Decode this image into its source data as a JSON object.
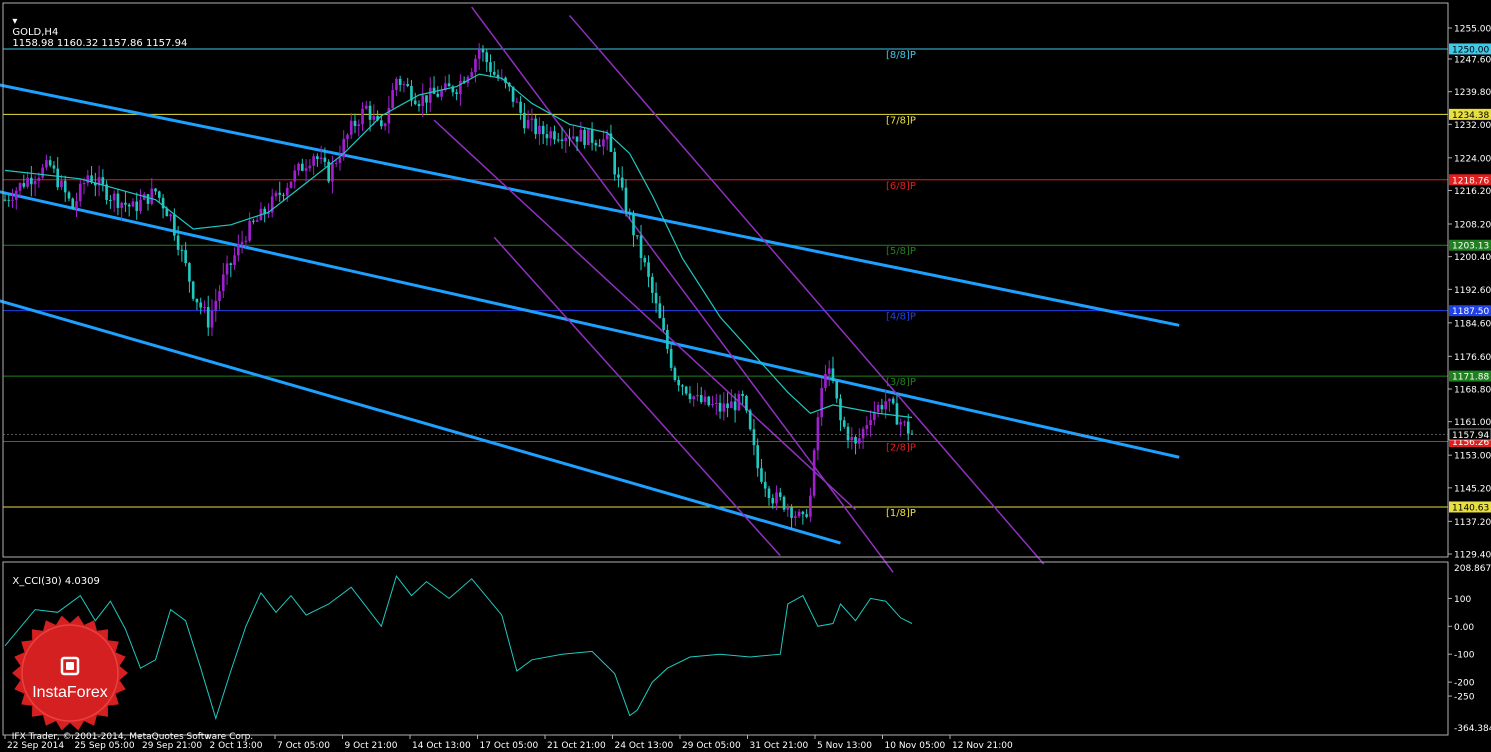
{
  "header": {
    "symbol": "GOLD,H4",
    "ohlc": "1158.98 1160.32 1157.86 1157.94",
    "indicator": "X_CCI(30) 4.0309"
  },
  "footer": {
    "copyright": "IFX Trader, © 2001-2014, MetaQuotes Software Corp."
  },
  "logo": {
    "text": "InstaForex",
    "color": "#d42020"
  },
  "colors": {
    "background": "#000000",
    "bull": "#a020d0",
    "bear": "#20c8c0",
    "ma": "#20c8c0",
    "channel_outer": "#1ea0ff",
    "channel_inner": "#9030c0",
    "cci": "#20c8c0"
  },
  "chart_data": [
    {
      "type": "candlestick",
      "symbol": "GOLD",
      "timeframe": "H4",
      "y_ticks": [
        1255.0,
        1247.6,
        1239.8,
        1232.0,
        1224.0,
        1216.2,
        1208.2,
        1200.4,
        1192.6,
        1184.6,
        1176.6,
        1168.8,
        1161.0,
        1153.0,
        1145.2,
        1137.2,
        1129.4
      ],
      "ylim": [
        1129.4,
        1255.0
      ],
      "x_ticks": [
        "22 Sep 2014",
        "25 Sep 05:00",
        "29 Sep 21:00",
        "2 Oct 13:00",
        "7 Oct 05:00",
        "9 Oct 21:00",
        "14 Oct 13:00",
        "17 Oct 05:00",
        "21 Oct 21:00",
        "24 Oct 13:00",
        "29 Oct 05:00",
        "31 Oct 21:00",
        "5 Nov 13:00",
        "10 Nov 05:00",
        "12 Nov 21:00"
      ],
      "path_points": [
        [
          0,
          1214
        ],
        [
          6,
          1219
        ],
        [
          12,
          1222
        ],
        [
          18,
          1212
        ],
        [
          22,
          1220
        ],
        [
          28,
          1215
        ],
        [
          34,
          1212
        ],
        [
          40,
          1216
        ],
        [
          44,
          1210
        ],
        [
          50,
          1192
        ],
        [
          54,
          1185
        ],
        [
          58,
          1195
        ],
        [
          64,
          1206
        ],
        [
          70,
          1212
        ],
        [
          76,
          1219
        ],
        [
          82,
          1225
        ],
        [
          86,
          1220
        ],
        [
          92,
          1231
        ],
        [
          96,
          1236
        ],
        [
          100,
          1230
        ],
        [
          104,
          1243
        ],
        [
          110,
          1238
        ],
        [
          114,
          1239
        ],
        [
          120,
          1241
        ],
        [
          124,
          1246
        ],
        [
          126,
          1250
        ],
        [
          130,
          1244
        ],
        [
          134,
          1240
        ],
        [
          138,
          1233
        ],
        [
          142,
          1230
        ],
        [
          148,
          1230
        ],
        [
          154,
          1229
        ],
        [
          160,
          1228
        ],
        [
          164,
          1215
        ],
        [
          170,
          1198
        ],
        [
          174,
          1185
        ],
        [
          178,
          1172
        ],
        [
          184,
          1166
        ],
        [
          190,
          1164
        ],
        [
          196,
          1166
        ],
        [
          200,
          1150
        ],
        [
          204,
          1143
        ],
        [
          208,
          1141
        ],
        [
          212,
          1137
        ],
        [
          214,
          1143
        ],
        [
          216,
          1162
        ],
        [
          218,
          1174
        ],
        [
          220,
          1170
        ],
        [
          222,
          1161
        ],
        [
          226,
          1155
        ],
        [
          230,
          1163
        ],
        [
          234,
          1166
        ],
        [
          238,
          1161
        ],
        [
          241,
          1158
        ]
      ],
      "moving_average": [
        [
          0,
          1221
        ],
        [
          20,
          1219
        ],
        [
          40,
          1214
        ],
        [
          50,
          1207
        ],
        [
          60,
          1208
        ],
        [
          70,
          1211
        ],
        [
          80,
          1218
        ],
        [
          90,
          1225
        ],
        [
          100,
          1234
        ],
        [
          110,
          1239
        ],
        [
          120,
          1241
        ],
        [
          126,
          1244
        ],
        [
          132,
          1243
        ],
        [
          140,
          1237
        ],
        [
          150,
          1232
        ],
        [
          160,
          1230
        ],
        [
          166,
          1225
        ],
        [
          172,
          1215
        ],
        [
          180,
          1200
        ],
        [
          190,
          1186
        ],
        [
          200,
          1176
        ],
        [
          208,
          1168
        ],
        [
          214,
          1163
        ],
        [
          220,
          1165
        ],
        [
          226,
          1164
        ],
        [
          232,
          1163
        ],
        [
          241,
          1162
        ]
      ],
      "horizontal_levels": [
        {
          "value": 1250.0,
          "label": "[8/8]P",
          "price_label": "1250.00",
          "color": "#40c8e8"
        },
        {
          "value": 1234.38,
          "label": "[7/8]P",
          "price_label": "1234.38",
          "color": "#e8e040"
        },
        {
          "value": 1218.76,
          "label": "[6/8]P",
          "price_label": "1218.76",
          "color": "#e02020"
        },
        {
          "value": 1203.13,
          "label": "[5/8]P",
          "price_label": "1203.13",
          "color": "#208020"
        },
        {
          "value": 1187.5,
          "label": "[4/8]P",
          "price_label": "1187.50",
          "color": "#2040e8"
        },
        {
          "value": 1171.88,
          "label": "[3/8]P",
          "price_label": "1171.88",
          "color": "#208020"
        },
        {
          "value": 1156.26,
          "label": "[2/8]P",
          "price_label": "1156.26",
          "color": "#e02020"
        },
        {
          "value": 1140.63,
          "label": "[1/8]P",
          "price_label": "1140.63",
          "color": "#e8e040"
        }
      ],
      "current_price": {
        "value": 1157.94,
        "label": "1157.94"
      },
      "trend_channels": [
        {
          "color": "#1ea0ff",
          "from": [
            -2,
            1241.5
          ],
          "to": [
            312,
            1184.0
          ]
        },
        {
          "color": "#1ea0ff",
          "from": [
            -2,
            1216.0
          ],
          "to": [
            312,
            1152.5
          ]
        },
        {
          "color": "#1ea0ff",
          "from": [
            -2,
            1190.0
          ],
          "to": [
            222,
            1132.0
          ]
        },
        {
          "color": "#9030c0",
          "from": [
            124,
            1260.0
          ],
          "to": [
            236,
            1125.0
          ]
        },
        {
          "color": "#9030c0",
          "from": [
            150,
            1258.0
          ],
          "to": [
            276,
            1127.0
          ]
        },
        {
          "color": "#9030c0",
          "from": [
            114,
            1233.0
          ],
          "to": [
            226,
            1140.0
          ]
        },
        {
          "color": "#9030c0",
          "from": [
            130,
            1205.0
          ],
          "to": [
            206,
            1129.0
          ]
        }
      ]
    },
    {
      "type": "line",
      "name": "X_CCI(30)",
      "y_ticks": [
        100,
        0,
        -100,
        -200,
        -250
      ],
      "scale_labels": {
        "top": "208.8672",
        "bottom": "-364.3846"
      },
      "ylim": [
        -364.3846,
        208.8672
      ],
      "values": [
        [
          0,
          -70
        ],
        [
          8,
          60
        ],
        [
          14,
          50
        ],
        [
          20,
          110
        ],
        [
          24,
          20
        ],
        [
          28,
          90
        ],
        [
          32,
          -10
        ],
        [
          36,
          -150
        ],
        [
          40,
          -120
        ],
        [
          44,
          60
        ],
        [
          48,
          20
        ],
        [
          52,
          -150
        ],
        [
          56,
          -330
        ],
        [
          60,
          -160
        ],
        [
          64,
          0
        ],
        [
          68,
          120
        ],
        [
          72,
          50
        ],
        [
          76,
          110
        ],
        [
          80,
          40
        ],
        [
          86,
          80
        ],
        [
          92,
          140
        ],
        [
          100,
          0
        ],
        [
          104,
          180
        ],
        [
          108,
          110
        ],
        [
          112,
          160
        ],
        [
          118,
          100
        ],
        [
          124,
          170
        ],
        [
          132,
          40
        ],
        [
          136,
          -160
        ],
        [
          140,
          -120
        ],
        [
          148,
          -100
        ],
        [
          156,
          -90
        ],
        [
          162,
          -170
        ],
        [
          166,
          -320
        ],
        [
          168,
          -300
        ],
        [
          172,
          -200
        ],
        [
          176,
          -150
        ],
        [
          182,
          -110
        ],
        [
          190,
          -100
        ],
        [
          198,
          -110
        ],
        [
          206,
          -100
        ],
        [
          208,
          80
        ],
        [
          212,
          110
        ],
        [
          216,
          0
        ],
        [
          220,
          10
        ],
        [
          222,
          80
        ],
        [
          226,
          20
        ],
        [
          230,
          100
        ],
        [
          234,
          90
        ],
        [
          238,
          30
        ],
        [
          241,
          10
        ]
      ]
    }
  ]
}
